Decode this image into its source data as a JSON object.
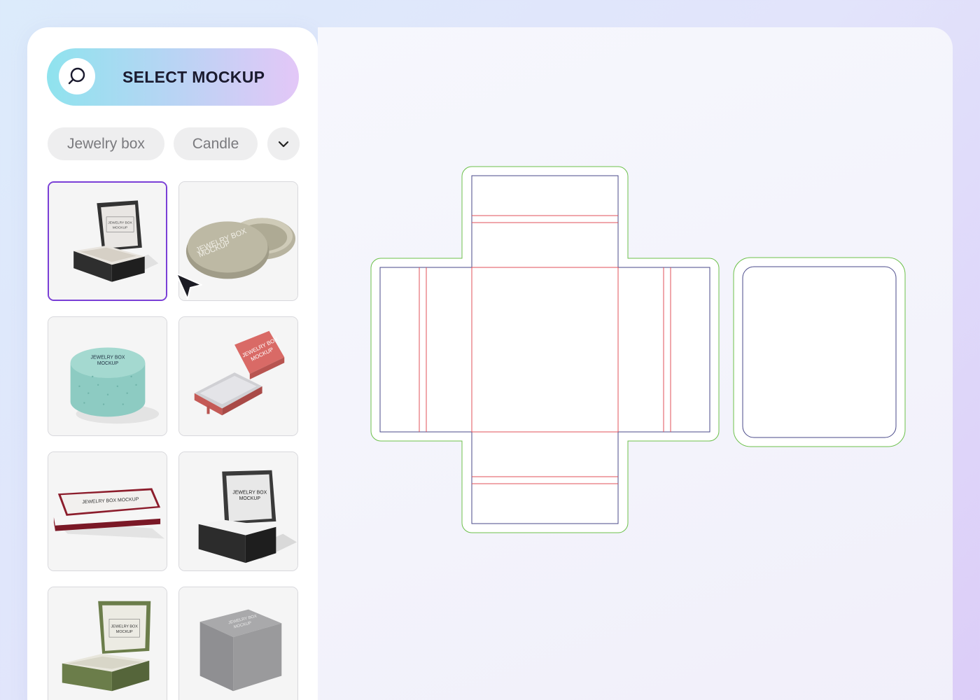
{
  "sidebar": {
    "select_button": {
      "label": "SELECT MOCKUP",
      "icon": "search-icon"
    },
    "filters": [
      {
        "label": "Jewelry box"
      },
      {
        "label": "Candle"
      }
    ],
    "more_filters_icon": "chevron-down-icon",
    "mockups": [
      {
        "name": "open-square-jewelry-box",
        "text": [
          "JEWELRY BOX",
          "MOCKUP"
        ],
        "selected": true
      },
      {
        "name": "round-lid-jewelry-box",
        "text": [
          "JEWELRY BOX",
          "MOCKUP"
        ],
        "selected": false
      },
      {
        "name": "cylinder-jewelry-box",
        "text": [
          "JEWELRY BOX",
          "MOCKUP"
        ],
        "selected": false
      },
      {
        "name": "drawer-jewelry-box",
        "text": [
          "JEWELRY BOX",
          "MOCKUP"
        ],
        "selected": false
      },
      {
        "name": "long-jewelry-box",
        "text": [
          "JEWELRY BOX MOCKUP"
        ],
        "selected": false
      },
      {
        "name": "ring-jewelry-box",
        "text": [
          "JEWELRY BOX",
          "MOCKUP"
        ],
        "selected": false
      },
      {
        "name": "green-jewelry-box",
        "text": [
          "JEWELRY BOX",
          "MOCKUP"
        ],
        "selected": false
      },
      {
        "name": "grey-cube-jewelry-box",
        "text": [
          "JEWELRY BOX",
          "MOCKUP"
        ],
        "selected": false
      }
    ]
  },
  "colors": {
    "accent": "#7a3fd6",
    "dieline_cut": "#4a4a8a",
    "dieline_fold": "#e0505a",
    "dieline_bleed": "#6cc04a"
  },
  "cursor": "arrow-cursor-icon"
}
